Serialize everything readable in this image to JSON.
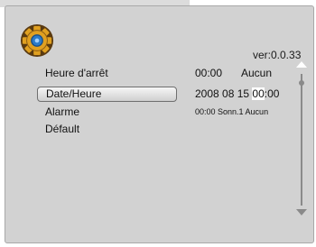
{
  "header": {
    "icon": "gear-icon",
    "version": "ver:0.0.33"
  },
  "menu": {
    "items": [
      {
        "label": "Heure d'arrêt",
        "selected": false
      },
      {
        "label": "Date/Heure",
        "selected": true
      },
      {
        "label": "Alarme",
        "selected": false
      },
      {
        "label": "Défault",
        "selected": false
      }
    ]
  },
  "values": {
    "stop_time": {
      "time": "00:00",
      "mode": "Aucun"
    },
    "date_time": {
      "date": "2008 08 15 ",
      "hour": "00",
      "minute_sep": ":00"
    },
    "alarm": "00:00 Sonn.1 Aucun"
  },
  "colors": {
    "panel_bg": "#d2d2d2",
    "gear_outer": "#6a4a1a",
    "gear_body": "#e0a020",
    "gear_center": "#2b7bc9"
  }
}
